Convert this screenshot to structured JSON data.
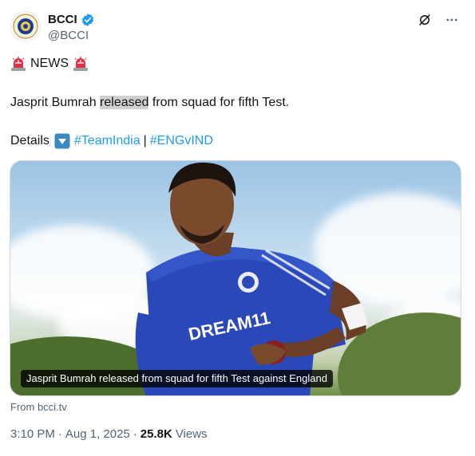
{
  "author": {
    "name": "BCCI",
    "handle": "@BCCI",
    "verified": true
  },
  "post": {
    "news_label": "NEWS",
    "emoji_left": "siren-icon",
    "emoji_right": "siren-icon",
    "main_before": "Jasprit Bumrah ",
    "main_highlight": "released",
    "main_after": " from squad for fifth Test.",
    "details_label": "Details",
    "details_emoji": "down-arrow-button-icon",
    "hashtag_1": "#TeamIndia",
    "separator": "|",
    "hashtag_2": "#ENGvIND"
  },
  "media": {
    "caption": "Jasprit Bumrah released from squad for fifth Test against England",
    "source": "From bcci.tv",
    "jersey_text": "DREAM11"
  },
  "meta": {
    "time": "3:10 PM",
    "dot": "·",
    "date": "Aug 1, 2025",
    "dot2": "·",
    "views_count": "25.8K",
    "views_label": "Views"
  },
  "colors": {
    "accent": "#1d9bf0",
    "text": "#0f1419",
    "secondary": "#536471",
    "jersey": "#2b48b8"
  }
}
